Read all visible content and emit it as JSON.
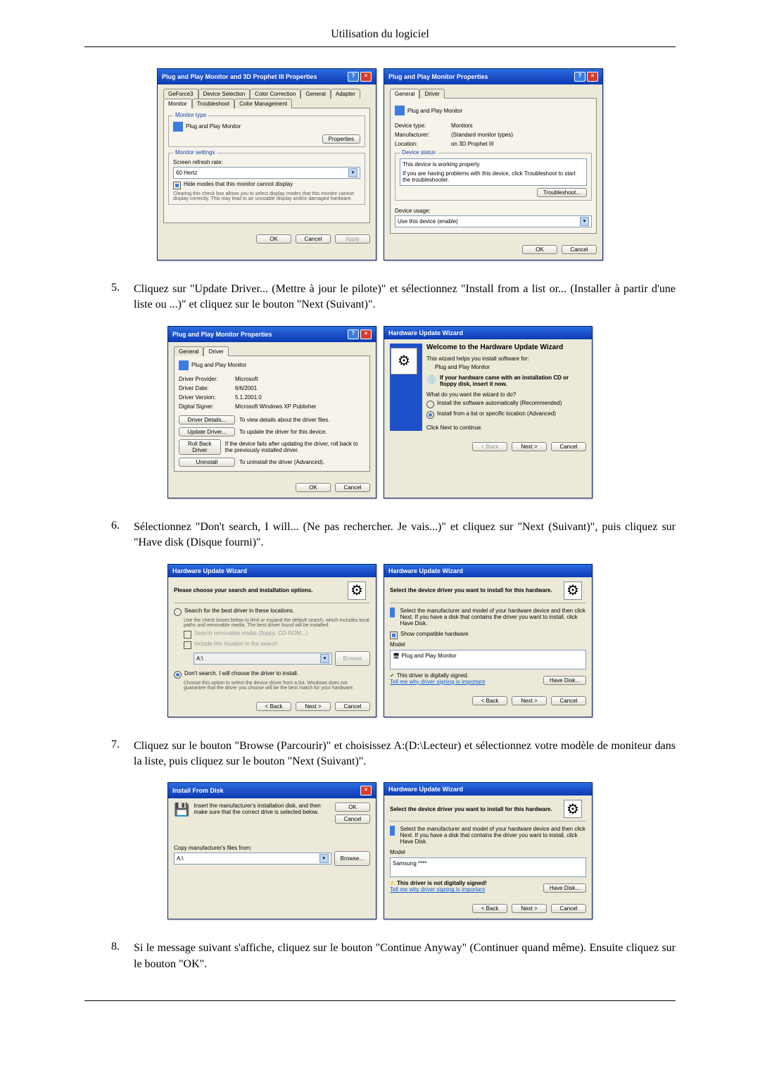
{
  "header": {
    "title": "Utilisation du logiciel"
  },
  "steps": {
    "s5": {
      "num": "5.",
      "text": "Cliquez sur \"Update Driver... (Mettre à jour le pilote)\" et sélectionnez \"Install from a list or... (Installer à partir d'une liste ou ...)\" et cliquez sur le bouton \"Next (Suivant)\"."
    },
    "s6": {
      "num": "6.",
      "text": "Sélectionnez \"Don't search, I will... (Ne pas rechercher. Je vais...)\" et cliquez sur \"Next (Suivant)\", puis cliquez sur \"Have disk (Disque fourni)\"."
    },
    "s7": {
      "num": "7.",
      "text": "Cliquez sur le bouton \"Browse (Parcourir)\" et choisissez A:(D:\\Lecteur) et sélectionnez votre modèle de moniteur dans la liste, puis cliquez sur le bouton \"Next (Suivant)\"."
    },
    "s8": {
      "num": "8.",
      "text": "Si le message suivant s'affiche, cliquez sur le bouton \"Continue Anyway\" (Continuer quand même). Ensuite cliquez sur le bouton \"OK\"."
    }
  },
  "fig1": {
    "left": {
      "title": "Plug and Play Monitor and 3D Prophet III Properties",
      "tabs": [
        "GeForce3",
        "Device Selection",
        "Color Correction",
        "General",
        "Adapter",
        "Monitor",
        "Troubleshoot",
        "Color Management"
      ],
      "active_tab": "Monitor",
      "group_monitor_type": "Monitor type",
      "monitor_name": "Plug and Play Monitor",
      "properties_btn": "Properties",
      "group_monitor_settings": "Monitor settings",
      "refresh_label": "Screen refresh rate:",
      "refresh_value": "60 Hertz",
      "hide_cb": "Hide modes that this monitor cannot display",
      "hide_desc": "Clearing this check box allows you to select display modes that this monitor cannot display correctly. This may lead to an unusable display and/or damaged hardware.",
      "ok": "OK",
      "cancel": "Cancel",
      "apply": "Apply"
    },
    "right": {
      "title": "Plug and Play Monitor Properties",
      "tabs": [
        "General",
        "Driver"
      ],
      "active_tab": "General",
      "monitor_name": "Plug and Play Monitor",
      "kv": {
        "device_type_k": "Device type:",
        "device_type_v": "Monitors",
        "manufacturer_k": "Manufacturer:",
        "manufacturer_v": "(Standard monitor types)",
        "location_k": "Location:",
        "location_v": "on 3D Prophet III"
      },
      "group_device_status": "Device status",
      "status_text": "This device is working properly.",
      "status_help": "If you are having problems with this device, click Troubleshoot to start the troubleshooter.",
      "troubleshoot_btn": "Troubleshoot...",
      "usage_label": "Device usage:",
      "usage_value": "Use this device (enable)",
      "ok": "OK",
      "cancel": "Cancel"
    }
  },
  "fig2": {
    "left": {
      "title": "Plug and Play Monitor Properties",
      "tabs": [
        "General",
        "Driver"
      ],
      "active_tab": "Driver",
      "monitor_name": "Plug and Play Monitor",
      "kv": {
        "provider_k": "Driver Provider:",
        "provider_v": "Microsoft",
        "date_k": "Driver Date:",
        "date_v": "6/6/2001",
        "version_k": "Driver Version:",
        "version_v": "5.1.2001.0",
        "signer_k": "Digital Signer:",
        "signer_v": "Microsoft Windows XP Publisher"
      },
      "btns": {
        "details": "Driver Details...",
        "details_desc": "To view details about the driver files.",
        "update": "Update Driver...",
        "update_desc": "To update the driver for this device.",
        "rollback": "Roll Back Driver",
        "rollback_desc": "If the device fails after updating the driver, roll back to the previously installed driver.",
        "uninstall": "Uninstall",
        "uninstall_desc": "To uninstall the driver (Advanced)."
      },
      "ok": "OK",
      "cancel": "Cancel"
    },
    "right": {
      "title": "Hardware Update Wizard",
      "welcome": "Welcome to the Hardware Update Wizard",
      "intro": "This wizard helps you install software for:",
      "device": "Plug and Play Monitor",
      "cd_hint": "If your hardware came with an installation CD or floppy disk, insert it now.",
      "question": "What do you want the wizard to do?",
      "opt_auto": "Install the software automatically (Recommended)",
      "opt_list": "Install from a list or specific location (Advanced)",
      "continue": "Click Next to continue.",
      "back": "< Back",
      "next": "Next >",
      "cancel": "Cancel"
    }
  },
  "fig3": {
    "left": {
      "title": "Hardware Update Wizard",
      "heading": "Please choose your search and installation options.",
      "opt_search": "Search for the best driver in these locations.",
      "search_desc": "Use the check boxes below to limit or expand the default search, which includes local paths and removable media. The best driver found will be installed.",
      "cb_media": "Search removable media (floppy, CD-ROM...)",
      "cb_location": "Include this location in the search:",
      "path": "A:\\",
      "browse": "Browse",
      "opt_dont": "Don't search. I will choose the driver to install.",
      "dont_desc": "Choose this option to select the device driver from a list. Windows does not guarantee that the driver you choose will be the best match for your hardware.",
      "back": "< Back",
      "next": "Next >",
      "cancel": "Cancel"
    },
    "right": {
      "title": "Hardware Update Wizard",
      "heading": "Select the device driver you want to install for this hardware.",
      "desc": "Select the manufacturer and model of your hardware device and then click Next. If you have a disk that contains the driver you want to install, click Have Disk.",
      "cb_compat": "Show compatible hardware",
      "model_label": "Model",
      "model_item": "Plug and Play Monitor",
      "signed": "This driver is digitally signed.",
      "signed_link": "Tell me why driver signing is important",
      "have_disk": "Have Disk...",
      "back": "< Back",
      "next": "Next >",
      "cancel": "Cancel"
    }
  },
  "fig4": {
    "left": {
      "title": "Install From Disk",
      "instr": "Insert the manufacturer's installation disk, and then make sure that the correct drive is selected below.",
      "ok": "OK",
      "cancel": "Cancel",
      "copy_label": "Copy manufacturer's files from:",
      "path": "A:\\",
      "browse": "Browse..."
    },
    "right": {
      "title": "Hardware Update Wizard",
      "heading": "Select the device driver you want to install for this hardware.",
      "desc": "Select the manufacturer and model of your hardware device and then click Next. If you have a disk that contains the driver you want to install, click Have Disk.",
      "model_label": "Model",
      "model_item": "Samsung ****",
      "warn": "This driver is not digitally signed!",
      "warn_link": "Tell me why driver signing is important",
      "have_disk": "Have Disk...",
      "back": "< Back",
      "next": "Next >",
      "cancel": "Cancel"
    }
  }
}
